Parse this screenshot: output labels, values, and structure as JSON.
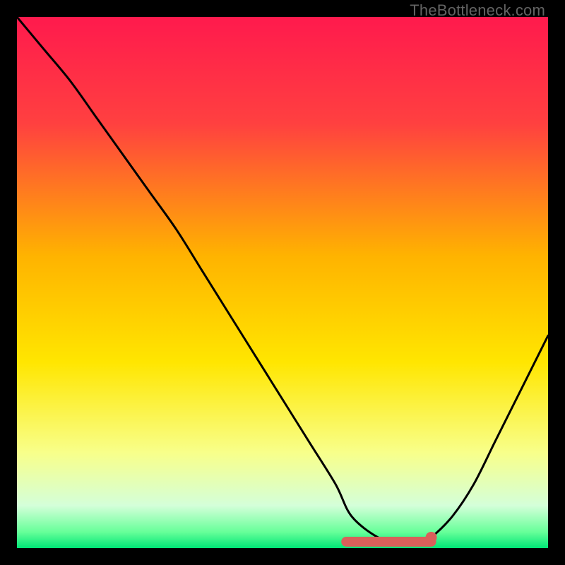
{
  "watermark": "TheBottleneck.com",
  "chart_data": {
    "type": "line",
    "title": "",
    "xlabel": "",
    "ylabel": "",
    "xlim": [
      0,
      100
    ],
    "ylim": [
      0,
      100
    ],
    "gradient_stops": [
      {
        "offset": 0,
        "color": "#ff1a4d"
      },
      {
        "offset": 20,
        "color": "#ff4040"
      },
      {
        "offset": 45,
        "color": "#ffb300"
      },
      {
        "offset": 65,
        "color": "#ffe600"
      },
      {
        "offset": 82,
        "color": "#f8ff8a"
      },
      {
        "offset": 92,
        "color": "#d4ffd9"
      },
      {
        "offset": 97,
        "color": "#66ff99"
      },
      {
        "offset": 100,
        "color": "#00e676"
      }
    ],
    "series": [
      {
        "name": "bottleneck-curve",
        "x": [
          0,
          5,
          10,
          15,
          20,
          25,
          30,
          35,
          40,
          45,
          50,
          55,
          60,
          63,
          68,
          72,
          76,
          78,
          82,
          86,
          90,
          94,
          98,
          100
        ],
        "values": [
          100,
          94,
          88,
          81,
          74,
          67,
          60,
          52,
          44,
          36,
          28,
          20,
          12,
          6,
          2,
          1,
          1,
          2,
          6,
          12,
          20,
          28,
          36,
          40
        ]
      }
    ],
    "highlight_band": {
      "x_start": 62,
      "x_end": 78,
      "y": 1.2
    },
    "marker": {
      "x": 78,
      "y": 2.0
    }
  }
}
